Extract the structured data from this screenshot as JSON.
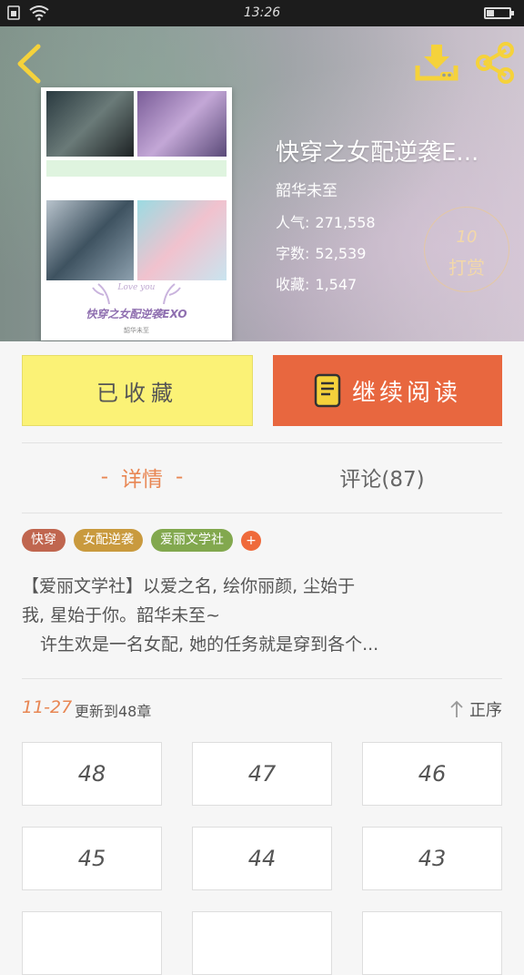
{
  "status_bar": {
    "time": "13:26"
  },
  "header": {
    "cover": {
      "title": "快穿之女配逆袭EXO",
      "author": "韶华未至",
      "overlay": "Love  you"
    },
    "title": "快穿之女配逆袭E...",
    "author": "韶华未至",
    "stats": {
      "popularity_label": "人气:",
      "popularity": "271,558",
      "words_label": "字数:",
      "words": "52,539",
      "favorites_label": "收藏:",
      "favorites": "1,547"
    },
    "reward": {
      "count": "10",
      "label": "打赏"
    },
    "icons": {
      "back": "back-arrow-icon",
      "download": "download-icon",
      "share": "share-icon"
    }
  },
  "actions": {
    "favorite_label": "已收藏",
    "read_label": "继续阅读"
  },
  "tabs": {
    "detail": "详情",
    "detail_dash": "-",
    "comments": "评论(87)"
  },
  "tags": [
    {
      "label": "快穿",
      "color": "#c0664f"
    },
    {
      "label": "女配逆袭",
      "color": "#c99a3e"
    },
    {
      "label": "爱丽文学社",
      "color": "#82a84e"
    }
  ],
  "tag_add": "+",
  "summary": {
    "line1": "【爱丽文学社】以爱之名, 绘你丽颜, 尘始于",
    "line2": "我, 星始于你。韶华未至~",
    "line3": "许生欢是一名女配, 她的任务就是穿到各个..."
  },
  "update": {
    "date": "11-27",
    "text": "更新到48章",
    "sort": "正序"
  },
  "chapters": [
    "48",
    "47",
    "46",
    "45",
    "44",
    "43",
    "",
    "",
    ""
  ],
  "colors": {
    "accent": "#e8673f",
    "favorite_bg": "#fbf276",
    "tab_active": "#e88653"
  }
}
